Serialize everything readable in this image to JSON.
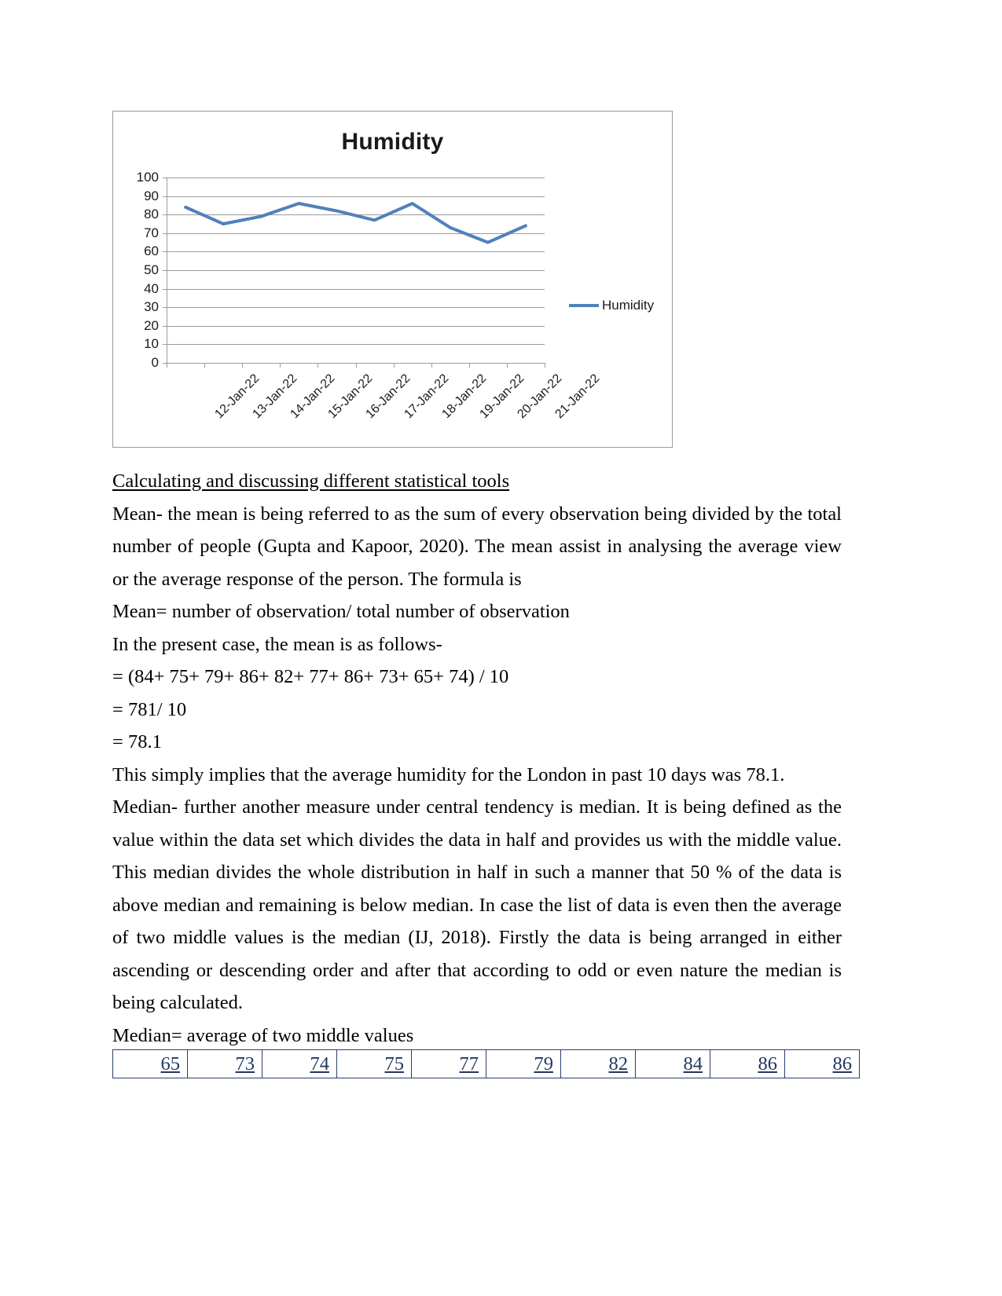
{
  "chart_data": {
    "type": "line",
    "title": "Humidity",
    "xlabel": "",
    "ylabel": "",
    "ylim": [
      0,
      100
    ],
    "ytick_step": 10,
    "yticks": [
      100,
      90,
      80,
      70,
      60,
      50,
      40,
      30,
      20,
      10,
      0
    ],
    "grid": true,
    "legend_position": "right",
    "categories": [
      "12-Jan-22",
      "13-Jan-22",
      "14-Jan-22",
      "15-Jan-22",
      "16-Jan-22",
      "17-Jan-22",
      "18-Jan-22",
      "19-Jan-22",
      "20-Jan-22",
      "21-Jan-22"
    ],
    "series": [
      {
        "name": "Humidity",
        "color": "#4f81bd",
        "values": [
          84,
          75,
          79,
          86,
          82,
          77,
          86,
          73,
          65,
          74
        ]
      }
    ]
  },
  "document": {
    "heading": "Calculating and discussing different statistical tools",
    "paragraphs": [
      "Mean- the mean is being referred to as the sum of every observation being divided by the total number of people (Gupta and Kapoor, 2020). The mean assist in analysing the average view or the average response of the person. The formula is",
      "Mean= number of observation/ total number of observation",
      "In the present case, the mean is as follows-",
      "= (84+ 75+ 79+ 86+ 82+ 77+ 86+ 73+ 65+ 74) / 10",
      "= 781/ 10",
      "= 78.1",
      "This simply implies that the average humidity for the London in past 10 days was 78.1.",
      "Median- further another measure under central tendency is median. It is being defined as the value within the data set which divides the data in half and provides us with the middle value. This median divides the whole distribution in half in such a manner that 50 % of the data is above median and remaining is below median. In case the list of data is even then the average of two middle values is the median (IJ, 2018). Firstly the data is being arranged in either ascending or descending order and after that according to odd or even nature the median is being calculated.",
      "Median= average of two middle values"
    ]
  },
  "sorted_values_table": {
    "values": [
      "65",
      "73",
      "74",
      "75",
      "77",
      "79",
      "82",
      "84",
      "86",
      "86"
    ]
  }
}
